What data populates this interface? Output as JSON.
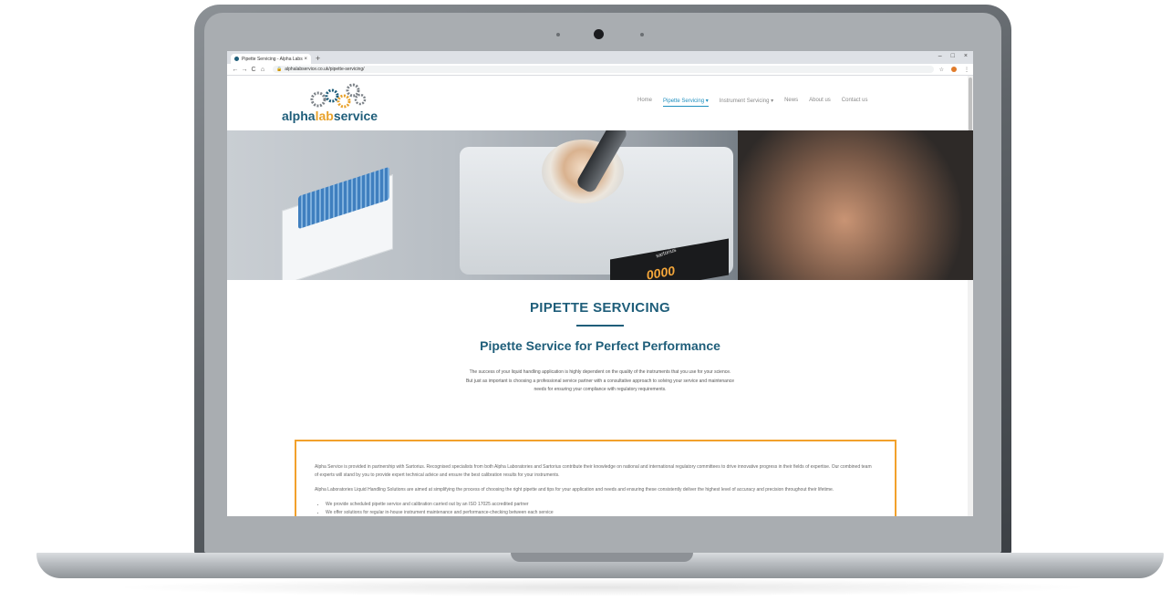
{
  "browser": {
    "tab_title": "Pipette Servicing - Alpha Labs",
    "tab_close": "×",
    "new_tab": "+",
    "url": "alphalabservice.co.uk/pipette-servicing/",
    "window_controls": [
      "–",
      "□",
      "×"
    ]
  },
  "site": {
    "logo": {
      "part1": "alpha",
      "part2": "lab",
      "part3": "service"
    },
    "nav": [
      {
        "label": "Home"
      },
      {
        "label": "Pipette Servicing ▾"
      },
      {
        "label": "Instrument Servicing ▾"
      },
      {
        "label": "News"
      },
      {
        "label": "About us"
      },
      {
        "label": "Contact us"
      }
    ]
  },
  "hero": {
    "brand": "sartorius",
    "display_value": "0000"
  },
  "content": {
    "page_title": "PIPETTE SERVICING",
    "subtitle": "Pipette Service for Perfect Performance",
    "intro_lines": [
      "The success of your liquid handling application is highly dependent on the quality of the instruments that you use for your science.",
      "But just as important is choosing a professional service partner with a consultative approach to solving your service and maintenance",
      "needs for ensuring your compliance with regulatory requirements."
    ],
    "box_paragraphs": [
      "Alpha Service is provided in partnership with Sartorius. Recognised specialists from both Alpha Laboratories and Sartorius contribute their knowledge on national and international regulatory committees to drive innovative progress in their fields of expertise. Our combined team of experts will stand by you to provide expert technical advice and ensure the best calibration results for your instruments.",
      "Alpha Laboratories Liquid Handling Solutions are aimed at simplifying the process of choosing the right pipette and tips for your application and needs and ensuring these consistently deliver the highest level of accuracy and precision throughout their lifetime."
    ],
    "box_bullets": [
      "We provide scheduled pipette service and calibration carried out by an ISO 17025 accredited partner",
      "We offer solutions for regular in-house instrument maintenance and performance-checking between each service"
    ]
  },
  "colors": {
    "brand_blue": "#1f5e7a",
    "brand_orange": "#f2a12b",
    "nav_active": "#1f8fbf"
  }
}
